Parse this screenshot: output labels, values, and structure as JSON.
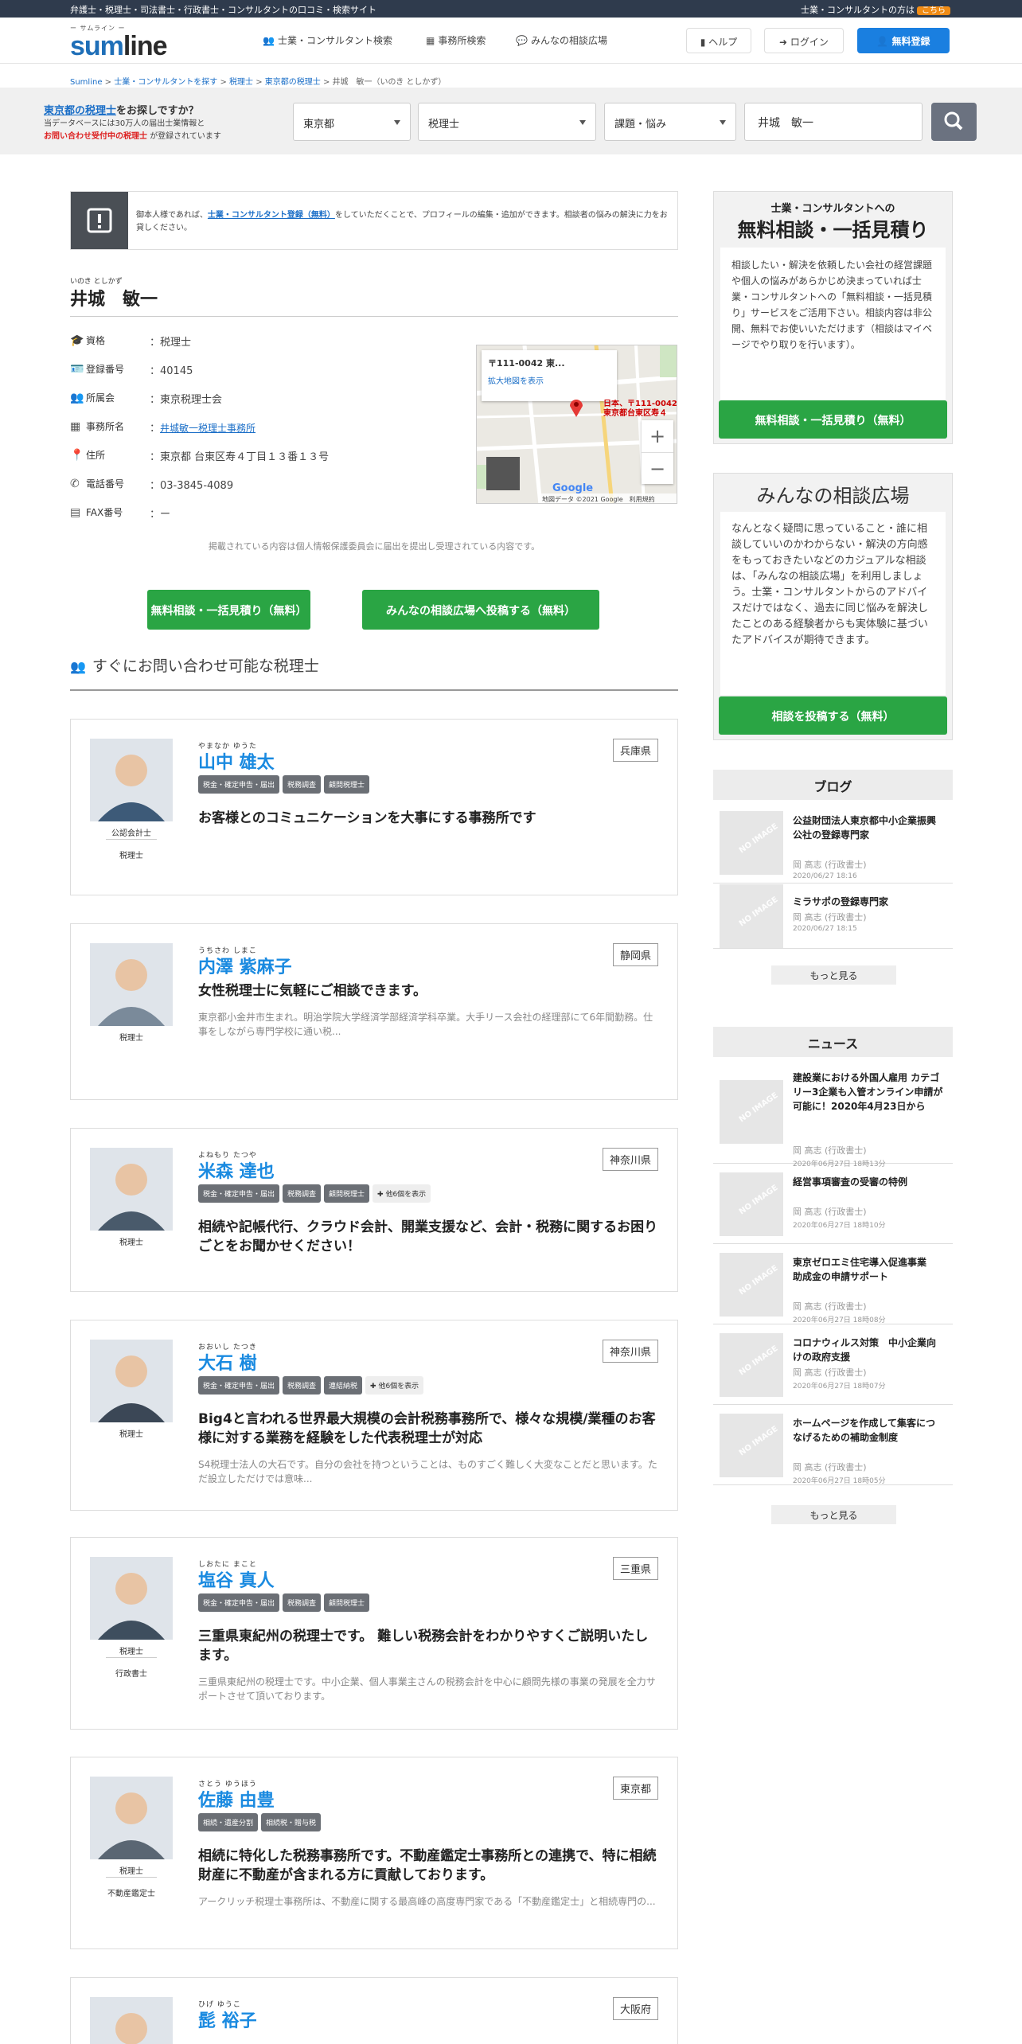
{
  "topbar": {
    "tagline": "弁護士・税理士・司法書士・行政書士・コンサルタントの口コミ・検索サイト",
    "pro_text": "士業・コンサルタントの方は",
    "pro_link": "こちら"
  },
  "logo": {
    "kana": "ー サムライン ー",
    "word_a": "sum",
    "word_b": "line"
  },
  "nav": {
    "search": "士業・コンサルタント検索",
    "office": "事務所検索",
    "forum": "みんなの相談広場",
    "help": "ヘルプ",
    "login": "ログイン",
    "register": "無料登録"
  },
  "breadcrumb": {
    "home": "Sumline",
    "b1": "士業・コンサルタントを探す",
    "b2": "税理士",
    "b3": "東京都の税理士",
    "current": "井城　敏一（いのき としかず）",
    "sep": ">"
  },
  "search": {
    "q_link": "東京都の税理士",
    "q_rest": "をお探しですか？",
    "line1": "当データベースには30万人の届出士業情報と",
    "line2_red": "お問い合わせ受付中の税理士",
    "line2_rest": "が登録されています",
    "pref": "東京都",
    "profession": "税理士",
    "issue": "課題・悩み",
    "name": "井城　敏一"
  },
  "notice": {
    "pre": "御本人様であれば、",
    "link": "士業・コンサルタント登録（無料）",
    "post": "をしていただくことで、プロフィールの編集・追加ができます。相談者の悩みの解決に力をお貸しください。"
  },
  "profile": {
    "kana": "いのき としかず",
    "name": "井城　敏一",
    "rows": [
      {
        "label": "資格",
        "icon": "graduation-cap-icon",
        "value": "：税理士"
      },
      {
        "label": "登録番号",
        "icon": "id-card-icon",
        "value": "：40145"
      },
      {
        "label": "所属会",
        "icon": "users-icon",
        "value": "：東京税理士会"
      },
      {
        "label": "事務所名",
        "icon": "building-icon",
        "value": "：",
        "link": "井城敏一税理士事務所"
      },
      {
        "label": "住所",
        "icon": "map-pin-icon",
        "value": "：東京都 台東区寿４丁目１３番１３号"
      },
      {
        "label": "電話番号",
        "icon": "phone-icon",
        "value": "：03-3845-4089"
      },
      {
        "label": "FAX番号",
        "icon": "fax-icon",
        "value": "：ー"
      }
    ],
    "map": {
      "postal": "〒111-0042 東...",
      "enlarge": "拡大地図を表示",
      "credit": "地図データ ©2021 Google",
      "terms": "利用規約",
      "google": "Google",
      "pin_label": "日本、〒111-0042 東京都台東区寿４",
      "plus": "+",
      "minus": "−"
    },
    "disclaimer": "掲載されている内容は個人情報保護委員会に届出を提出し受理されている内容です。",
    "btn_consult": "無料相談・一括見積り（無料）",
    "btn_post": "みんなの相談広場へ投稿する（無料）"
  },
  "section_title": "すぐにお問い合わせ可能な税理士",
  "advisors": [
    {
      "kana": "やまなか ゆうた",
      "name": "山中 雄太",
      "pref": "兵庫県",
      "roles": [
        "公認会計士",
        "税理士"
      ],
      "tags": [
        "税金・確定申告・届出",
        "税務調査",
        "顧問税理士"
      ],
      "catch": "お客様とのコミュニケーションを大事にする事務所です",
      "desc": ""
    },
    {
      "kana": "うちさわ しまこ",
      "name": "内澤 紫麻子",
      "pref": "静岡県",
      "roles": [
        "税理士"
      ],
      "tags": [],
      "catch": "女性税理士に気軽にご相談できます。",
      "desc": "東京都小金井市生まれ。明治学院大学経済学部経済学科卒業。大手リース会社の経理部にて6年間勤務。仕事をしながら専門学校に通い税..."
    },
    {
      "kana": "よねもり たつや",
      "name": "米森 達也",
      "pref": "神奈川県",
      "roles": [
        "税理士"
      ],
      "tags": [
        "税金・確定申告・届出",
        "税務調査",
        "顧問税理士"
      ],
      "more": "✚ 他6個を表示",
      "catch": "相続や記帳代行、クラウド会計、開業支援など、会計・税務に関するお困りごとをお聞かせください！",
      "desc": ""
    },
    {
      "kana": "おおいし たつき",
      "name": "大石 樹",
      "pref": "神奈川県",
      "roles": [
        "税理士"
      ],
      "tags": [
        "税金・確定申告・届出",
        "税務調査",
        "連結納税"
      ],
      "more": "✚ 他6個を表示",
      "catch": "Big4と言われる世界最大規模の会計税務事務所で、様々な規模/業種のお客様に対する業務を経験をした代表税理士が対応",
      "desc": "S4税理士法人の大石です。自分の会社を持つということは、ものすごく難しく大変なことだと思います。ただ設立しただけでは意味..."
    },
    {
      "kana": "しおたに まこと",
      "name": "塩谷 真人",
      "pref": "三重県",
      "roles": [
        "税理士",
        "行政書士"
      ],
      "tags": [
        "税金・確定申告・届出",
        "税務調査",
        "顧問税理士"
      ],
      "catch": "三重県東紀州の税理士です。 難しい税務会計をわかりやすくご説明いたします。",
      "desc": "三重県東紀州の税理士です。中小企業、個人事業主さんの税務会計を中心に顧問先様の事業の発展を全力サポートさせて頂いております。"
    },
    {
      "kana": "さとう ゆうほう",
      "name": "佐藤 由豊",
      "pref": "東京都",
      "roles": [
        "税理士",
        "不動産鑑定士"
      ],
      "tags": [
        "相続・遺産分割",
        "相続税・贈与税"
      ],
      "catch": "相続に特化した税務事務所です。不動産鑑定士事務所との連携で、特に相続財産に不動産が含まれる方に貢献しております。",
      "desc": "アークリッチ税理士事務所は、不動産に関する最高峰の高度専門家である「不動産鑑定士」と相続専門の..."
    },
    {
      "kana": "ひげ ゆうこ",
      "name": "髭 裕子",
      "pref": "大阪府",
      "roles": [],
      "tags": [],
      "catch": "",
      "desc": ""
    }
  ],
  "sidebar": {
    "box1": {
      "sub": "士業・コンサルタントへの",
      "title": "無料相談・一括見積り",
      "body": "相談したい・解決を依頼したい会社の経営課題や個人の悩みがあらかじめ決まっていれば士業・コンサルタントへの「無料相談・一括見積り」サービスをご活用下さい。相談内容は非公開、無料でお使いいただけます（相談はマイページでやり取りを行います）。",
      "btn": "無料相談・一括見積り（無料）"
    },
    "box2": {
      "title": "みんなの相談広場",
      "body": "なんとなく疑問に思っていること・誰に相談していいのかわからない・解決の方向感をもっておきたいなどのカジュアルな相談は、「みんなの相談広場」を利用しましょう。士業・コンサルタントからのアドバイスだけではなく、過去に同じ悩みを解決したことのある経験者からも実体験に基づいたアドバイスが期待できます。",
      "btn": "相談を投稿する（無料）"
    },
    "blog": {
      "title": "ブログ",
      "more": "もっと見る",
      "noimage": "NO IMAGE",
      "items": [
        {
          "t": "公益財団法人東京都中小企業振興公社の登録専門家",
          "a": "岡 高志 (行政書士)",
          "d": "2020/06/27 18:16"
        },
        {
          "t": "ミラサポの登録専門家",
          "a": "岡 高志 (行政書士)",
          "d": "2020/06/27 18:15"
        }
      ]
    },
    "news": {
      "title": "ニュース",
      "more": "もっと見る",
      "noimage": "NO IMAGE",
      "items": [
        {
          "t": "建設業における外国人雇用 カテゴリー3企業も入管オンライン申請が可能に！2020年4月23日から",
          "a": "岡 高志 (行政書士)",
          "d": "2020年06月27日 18時13分"
        },
        {
          "t": "経営事項審査の受審の特例",
          "a": "岡 高志 (行政書士)",
          "d": "2020年06月27日 18時10分"
        },
        {
          "t": "東京ゼロエミ住宅導入促進事業　助成金の申請サポート",
          "a": "岡 高志 (行政書士)",
          "d": "2020年06月27日 18時08分"
        },
        {
          "t": "コロナウィルス対策　中小企業向けの政府支援",
          "a": "岡 高志 (行政書士)",
          "d": "2020年06月27日 18時07分"
        },
        {
          "t": "ホームページを作成して集客につなげるための補助金制度",
          "a": "岡 高志 (行政書士)",
          "d": "2020年06月27日 18時05分"
        }
      ]
    }
  }
}
